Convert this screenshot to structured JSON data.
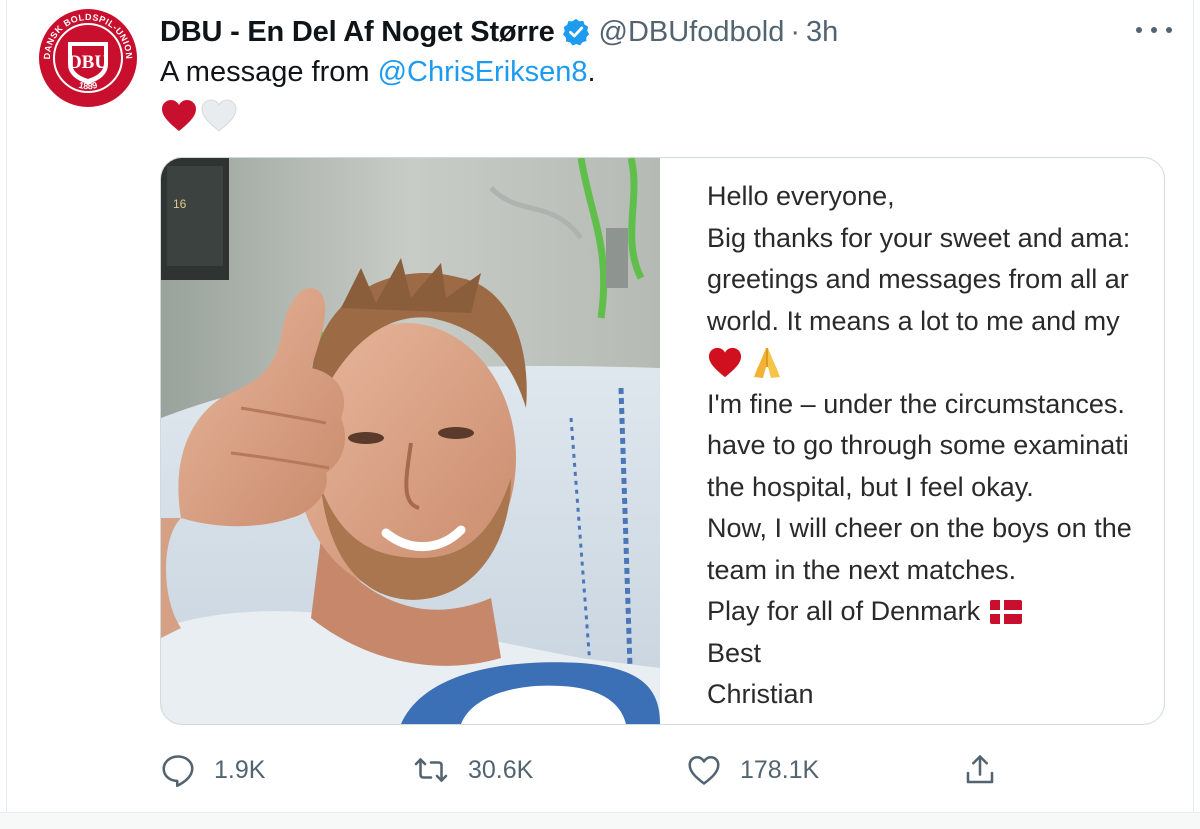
{
  "avatar": {
    "ring_text_top": "DANSK BOLDSPIL-UNION",
    "ring_text_bottom": "1889",
    "monogram": "DBU",
    "brand_color": "#c8102e"
  },
  "header": {
    "display_name": "DBU - En Del Af Noget Større",
    "verified_icon": "verified-badge-icon",
    "handle": "@DBUfodbold",
    "separator": "·",
    "time": "3h",
    "more_icon": "more-horizontal-icon"
  },
  "tweet": {
    "text_prefix": "A message from ",
    "mention": "@ChrisEriksen8",
    "text_suffix": ".",
    "emojis": [
      "red-heart",
      "white-heart"
    ]
  },
  "media": {
    "photo_icon": "photo-thumbs-up-hospital",
    "letter_lines": [
      "Hello everyone,",
      "Big thanks for your sweet and ama:",
      "greetings and messages from all ar",
      "world. It means a lot to me and my",
      "",
      "I'm fine – under the circumstances.",
      "have to go through some examinati",
      "the hospital, but I feel okay.",
      "Now, I will cheer on the boys on the",
      "team in the next matches.",
      "Play for all of Denmark",
      "Best",
      "Christian"
    ],
    "letter_emojis": [
      "red-heart",
      "folded-hands"
    ],
    "flag_emoji": "denmark-flag"
  },
  "actions": {
    "reply": {
      "icon": "reply-icon",
      "count": "1.9K"
    },
    "retweet": {
      "icon": "retweet-icon",
      "count": "30.6K"
    },
    "like": {
      "icon": "like-icon",
      "count": "178.1K"
    },
    "share": {
      "icon": "share-icon"
    }
  },
  "colors": {
    "accent": "#1d9bf0",
    "text": "#0f1419",
    "secondary": "#536471",
    "heart_red": "#c8102e",
    "flag_red": "#c8102e"
  }
}
